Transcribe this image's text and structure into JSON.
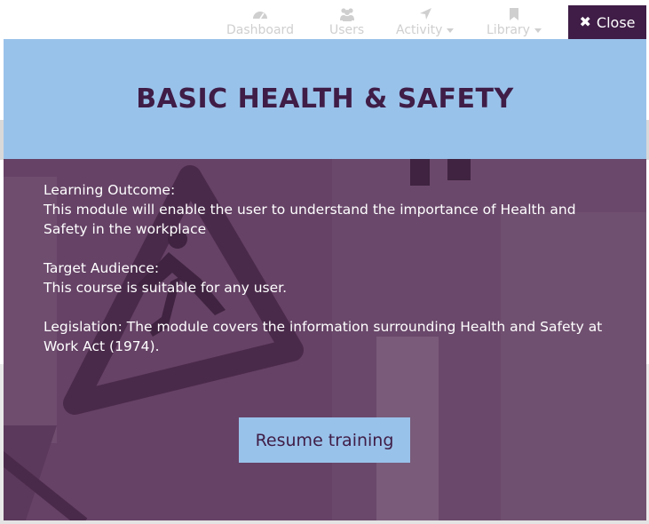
{
  "nav": {
    "items": [
      {
        "label": "Dashboard",
        "icon": "dashboard-icon",
        "has_caret": false
      },
      {
        "label": "Users",
        "icon": "users-icon",
        "has_caret": false
      },
      {
        "label": "Activity",
        "icon": "location-arrow-icon",
        "has_caret": true
      },
      {
        "label": "Library",
        "icon": "bookmark-icon",
        "has_caret": true
      }
    ]
  },
  "close_button": {
    "label": "Close",
    "icon": "close-icon"
  },
  "modal": {
    "title": "BASIC HEALTH & SAFETY",
    "learning_outcome_heading": "Learning Outcome:",
    "learning_outcome_text": "This module will enable the user to understand the importance of Health and Safety in the workplace",
    "target_audience_heading": "Target Audience:",
    "target_audience_text": "This course is suitable for any user.",
    "legislation_text": "Legislation: The module covers the information surrounding Health and Safety at Work Act (1974).",
    "resume_button": "Resume training",
    "background_image": "wet-floor-sign-photo"
  },
  "colors": {
    "brand_purple": "#3f1d46",
    "header_blue": "#99c2ea",
    "body_overlay": "#664266",
    "nav_text": "#cfcfcf"
  }
}
